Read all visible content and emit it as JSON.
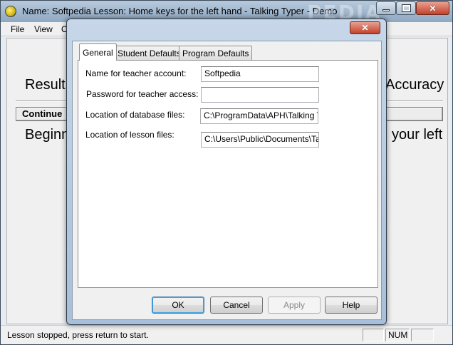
{
  "main_window": {
    "title": "Name: Softpedia  Lesson: Home keys for the left hand - Talking Typer - Demo",
    "watermark": "PEDIA",
    "menu": [
      "File",
      "View",
      "O"
    ],
    "client": {
      "results_partial": "Result",
      "accuracy_partial": "Accuracy",
      "continue_label": "Continue",
      "begin_partial": "Beginn",
      "your_left_partial": "your left"
    },
    "status": {
      "text": "Lesson stopped, press return to start.",
      "num_indicator": "NUM"
    }
  },
  "dialog": {
    "close_glyph": "✕",
    "tabs": [
      {
        "label": "General",
        "active": true
      },
      {
        "label": "Student Defaults",
        "active": false
      },
      {
        "label": "Program Defaults",
        "active": false
      }
    ],
    "fields": {
      "teacher_name_label": "Name for teacher account:",
      "teacher_name_value": "Softpedia",
      "teacher_password_label": "Password for teacher access:",
      "teacher_password_value": "",
      "database_label": "Location of database files:",
      "database_value": "C:\\ProgramData\\APH\\Talking Typ",
      "lesson_label": "Location of lesson files:",
      "lesson_value": "C:\\Users\\Public\\Documents\\Talki"
    },
    "buttons": {
      "ok": "OK",
      "cancel": "Cancel",
      "apply": "Apply",
      "help": "Help"
    }
  }
}
